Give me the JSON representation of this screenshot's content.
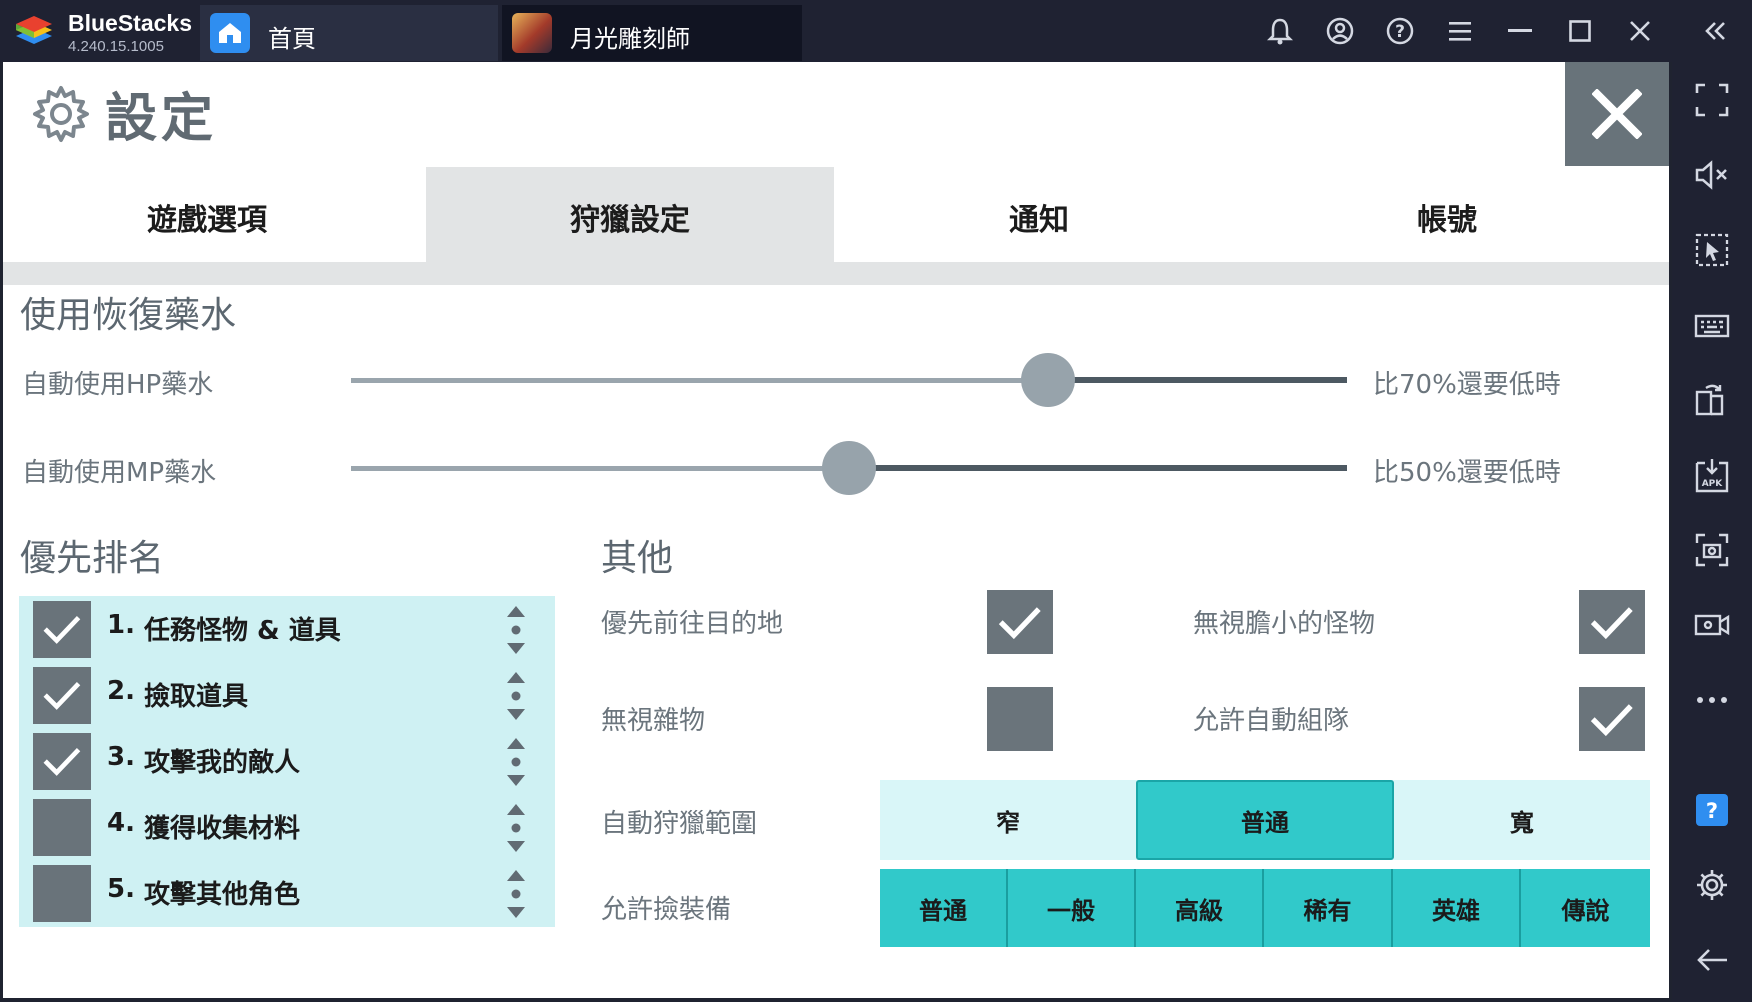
{
  "titlebar": {
    "app_name": "BlueStacks",
    "app_version": "4.240.15.1005",
    "tabs": [
      {
        "label": "首頁",
        "icon": "home-icon"
      },
      {
        "label": "月光雕刻師",
        "icon": "game-avatar-icon"
      }
    ],
    "buttons": [
      "bell-icon",
      "account-icon",
      "help-icon",
      "menu-icon",
      "minimize-icon",
      "maximize-icon",
      "close-icon",
      "collapse-sidebar-icon"
    ]
  },
  "sidebar": {
    "buttons": [
      "fullscreen-icon",
      "volume-mute-icon",
      "pointer-select-icon",
      "keyboard-icon",
      "rotate-icon",
      "install-apk-icon",
      "screenshot-icon",
      "record-icon",
      "more-icon",
      "help-icon",
      "settings-icon",
      "back-icon"
    ]
  },
  "settings": {
    "title": "設定",
    "tabs": [
      {
        "label": "遊戲選項",
        "active": false
      },
      {
        "label": "狩獵設定",
        "active": true
      },
      {
        "label": "通知",
        "active": false
      },
      {
        "label": "帳號",
        "active": false
      }
    ],
    "potion": {
      "title": "使用恢復藥水",
      "hp_label": "自動使用HP藥水",
      "hp_percent": 70,
      "hp_value_text": "比70%還要低時",
      "mp_label": "自動使用MP藥水",
      "mp_percent": 50,
      "mp_value_text": "比50%還要低時"
    },
    "priority": {
      "title": "優先排名",
      "items": [
        {
          "num": "1.",
          "label": "任務怪物 & 道具",
          "checked": true
        },
        {
          "num": "2.",
          "label": "撿取道具",
          "checked": true
        },
        {
          "num": "3.",
          "label": "攻擊我的敵人",
          "checked": true
        },
        {
          "num": "4.",
          "label": "獲得收集材料",
          "checked": false
        },
        {
          "num": "5.",
          "label": "攻擊其他角色",
          "checked": false
        }
      ]
    },
    "other": {
      "title": "其他",
      "options": [
        {
          "label": "優先前往目的地",
          "checked": true
        },
        {
          "label": "無視膽小的怪物",
          "checked": true
        },
        {
          "label": "無視雜物",
          "checked": false
        },
        {
          "label": "允許自動組隊",
          "checked": true
        }
      ],
      "range_label": "自動狩獵範圍",
      "range_options": [
        "窄",
        "普通",
        "寬"
      ],
      "range_selected": "普通",
      "equip_label": "允許撿裝備",
      "equip_options": [
        "普通",
        "一般",
        "高級",
        "稀有",
        "英雄",
        "傳說"
      ]
    }
  },
  "colors": {
    "titlebar_bg": "#1f2232",
    "panel_bg": "#ffffff",
    "row_bg": "#cff1f3",
    "accent": "#31c9ca",
    "checkbox_bg": "#69737a",
    "active_tab_bg": "#e2e4e5"
  }
}
